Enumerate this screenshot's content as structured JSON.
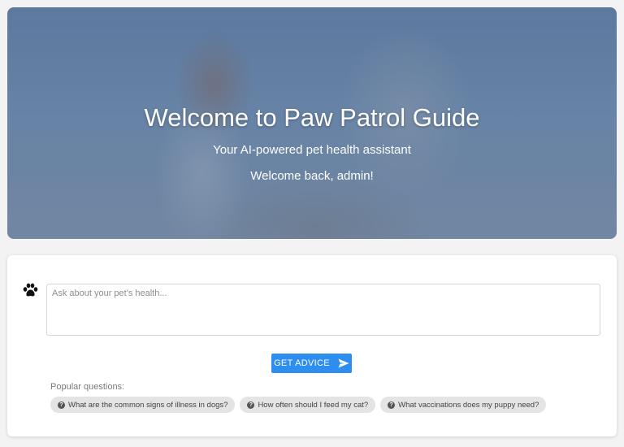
{
  "hero": {
    "title": "Welcome to Paw Patrol Guide",
    "subtitle": "Your AI-powered pet health assistant",
    "welcome": "Welcome back, admin!"
  },
  "ask": {
    "icon": "paw-icon",
    "placeholder": "Ask about your pet's health...",
    "value": "",
    "button_label": "GET ADVICE",
    "button_icon": "send-icon",
    "button_color": "#2e8ef0"
  },
  "popular": {
    "label": "Popular questions:",
    "icon": "question-circle-icon",
    "questions": [
      "What are the common signs of illness in dogs?",
      "How often should I feed my cat?",
      "What vaccinations does my puppy need?"
    ]
  }
}
